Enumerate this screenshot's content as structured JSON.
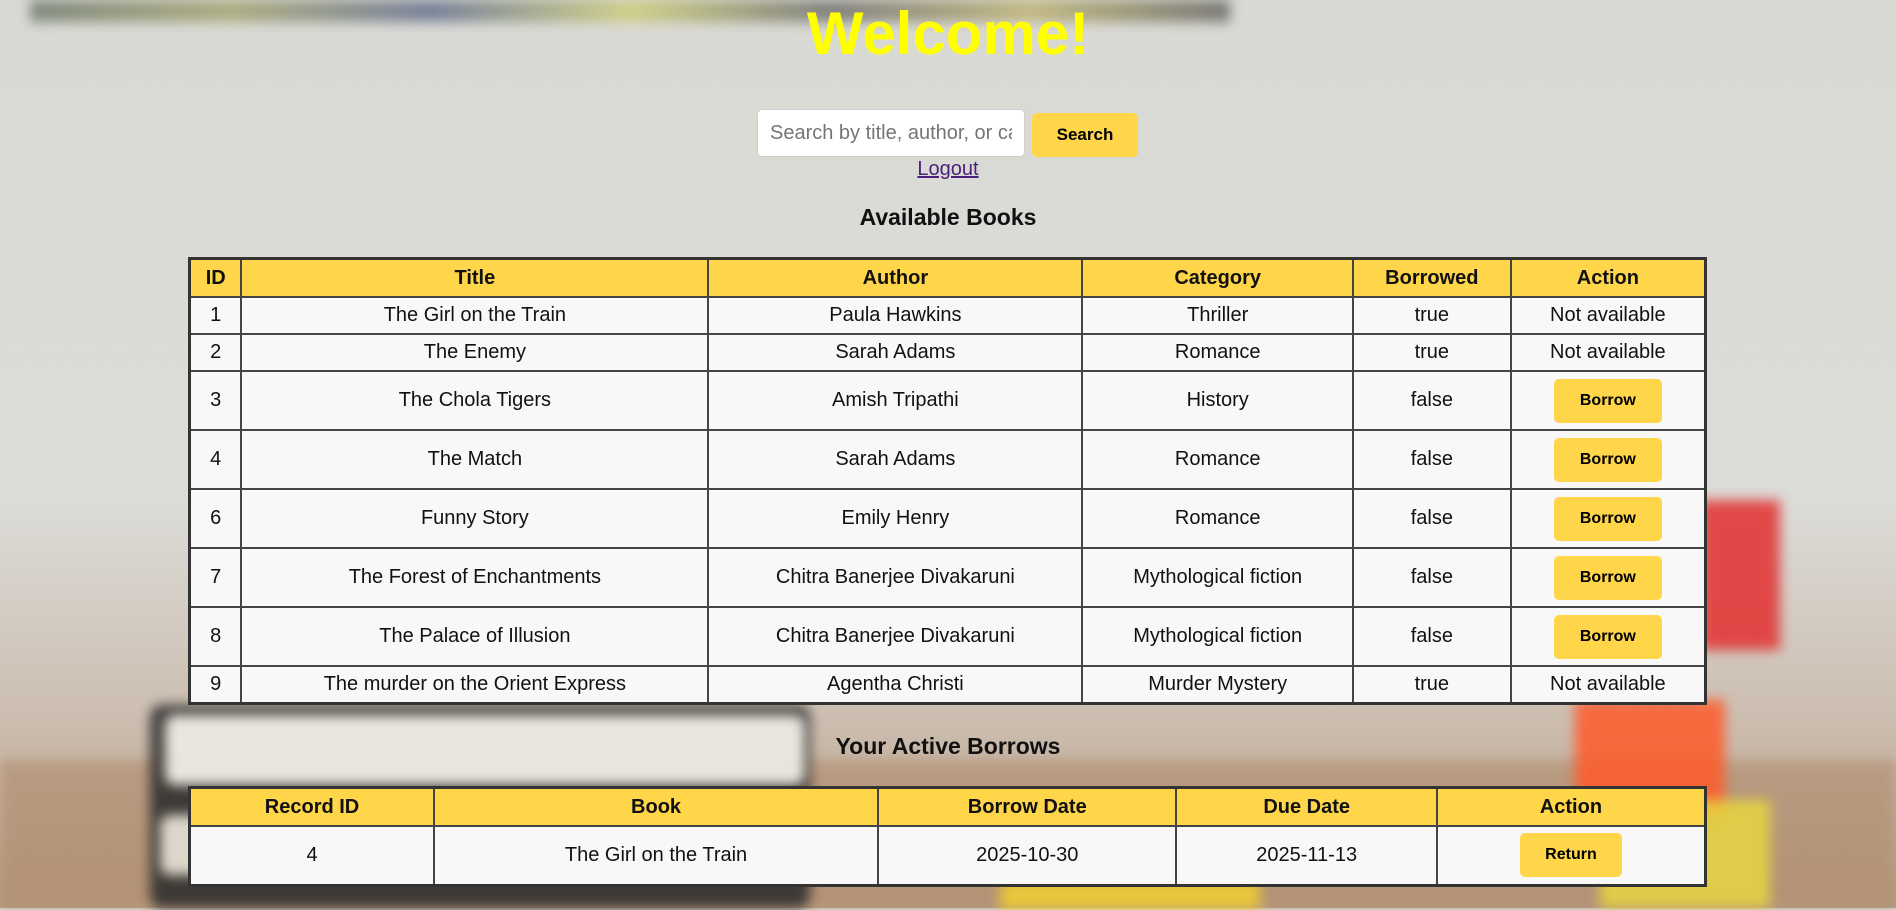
{
  "header": {
    "title": "Welcome!"
  },
  "search": {
    "placeholder": "Search by title, author, or category",
    "button_label": "Search"
  },
  "logout_label": "Logout",
  "books_section": {
    "title": "Available Books",
    "columns": [
      "ID",
      "Title",
      "Author",
      "Category",
      "Borrowed",
      "Action"
    ],
    "rows": [
      {
        "id": "1",
        "title": "The Girl on the Train",
        "author": "Paula Hawkins",
        "category": "Thriller",
        "borrowed": "true",
        "action": "Not available"
      },
      {
        "id": "2",
        "title": "The Enemy",
        "author": "Sarah Adams",
        "category": "Romance",
        "borrowed": "true",
        "action": "Not available"
      },
      {
        "id": "3",
        "title": "The Chola Tigers",
        "author": "Amish Tripathi",
        "category": "History",
        "borrowed": "false",
        "action": "Borrow"
      },
      {
        "id": "4",
        "title": "The Match",
        "author": "Sarah Adams",
        "category": "Romance",
        "borrowed": "false",
        "action": "Borrow"
      },
      {
        "id": "6",
        "title": "Funny Story",
        "author": "Emily Henry",
        "category": "Romance",
        "borrowed": "false",
        "action": "Borrow"
      },
      {
        "id": "7",
        "title": "The Forest of Enchantments",
        "author": "Chitra Banerjee Divakaruni",
        "category": "Mythological fiction",
        "borrowed": "false",
        "action": "Borrow"
      },
      {
        "id": "8",
        "title": "The Palace of Illusion",
        "author": "Chitra Banerjee Divakaruni",
        "category": "Mythological fiction",
        "borrowed": "false",
        "action": "Borrow"
      },
      {
        "id": "9",
        "title": "The murder on the Orient Express",
        "author": "Agentha Christi",
        "category": "Murder Mystery",
        "borrowed": "true",
        "action": "Not available"
      }
    ]
  },
  "borrows_section": {
    "title": "Your Active Borrows",
    "columns": [
      "Record ID",
      "Book",
      "Borrow Date",
      "Due Date",
      "Action"
    ],
    "rows": [
      {
        "record_id": "4",
        "book": "The Girl on the Train",
        "borrow_date": "2025-10-30",
        "due_date": "2025-11-13",
        "action": "Return"
      }
    ]
  },
  "colors": {
    "title": "#ffff00",
    "accent": "#ffd54a",
    "link": "#4b1f7a"
  }
}
